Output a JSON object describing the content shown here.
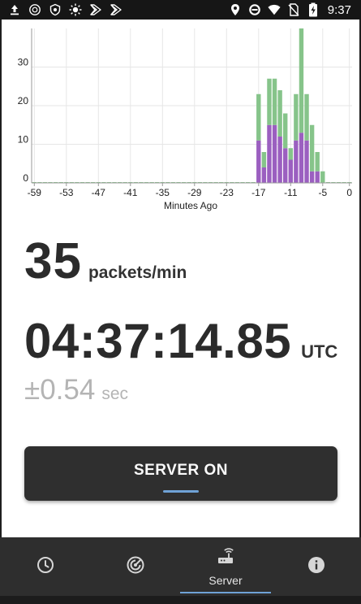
{
  "status_bar": {
    "left_icons": [
      "upload-icon",
      "app-circle-icon",
      "shield-badge-icon",
      "brightness-icon",
      "signal-flag-icon",
      "signal-flag-icon"
    ],
    "right_icons": [
      "location-icon",
      "do-not-disturb-icon",
      "wifi-icon",
      "no-sim-icon",
      "battery-charging-icon"
    ],
    "time": "9:37"
  },
  "chart_data": {
    "type": "bar",
    "stacked": true,
    "xlabel": "Minutes Ago",
    "ylabel": "",
    "xlim": [
      -59.5,
      0.5
    ],
    "ylim": [
      0,
      40
    ],
    "x_ticks": [
      -59,
      -53,
      -47,
      -41,
      -35,
      -29,
      -23,
      -17,
      -11,
      -5,
      0
    ],
    "y_ticks": [
      0,
      10,
      20,
      30
    ],
    "grid": true,
    "x": [
      -59,
      -58,
      -57,
      -56,
      -55,
      -54,
      -53,
      -52,
      -51,
      -50,
      -49,
      -48,
      -47,
      -46,
      -45,
      -44,
      -43,
      -42,
      -41,
      -40,
      -39,
      -38,
      -37,
      -36,
      -35,
      -34,
      -33,
      -32,
      -31,
      -30,
      -29,
      -28,
      -27,
      -26,
      -25,
      -24,
      -23,
      -22,
      -21,
      -20,
      -19,
      -18,
      -17,
      -16,
      -15,
      -14,
      -13,
      -12,
      -11,
      -10,
      -9,
      -8,
      -7,
      -6,
      -5,
      -4,
      -3,
      -2,
      -1,
      0
    ],
    "series": [
      {
        "color": "#9b5fc0",
        "values": [
          0,
          0,
          0,
          0,
          0,
          0,
          0,
          0,
          0,
          0,
          0,
          0,
          0,
          0,
          0,
          0,
          0,
          0,
          0,
          0,
          0,
          0,
          0,
          0,
          0,
          0,
          0,
          0,
          0,
          0,
          0,
          0,
          0,
          0,
          0,
          0,
          0,
          0,
          0,
          0,
          0,
          0,
          11,
          4,
          15,
          15,
          12,
          9,
          6,
          11,
          13,
          11,
          3,
          3,
          0,
          0,
          0,
          0,
          0,
          0
        ]
      },
      {
        "color": "#86c48a",
        "values": [
          0,
          0,
          0,
          0,
          0,
          0,
          0,
          0,
          0,
          0,
          0,
          0,
          0,
          0,
          0,
          0,
          0,
          0,
          0,
          0,
          0,
          0,
          0,
          0,
          0,
          0,
          0,
          0,
          0,
          0,
          0,
          0,
          0,
          0,
          0,
          0,
          0,
          0,
          0,
          0,
          0,
          0,
          12,
          4,
          12,
          12,
          12,
          9,
          3,
          12,
          27,
          12,
          12,
          5,
          3,
          0,
          0,
          0,
          0,
          0
        ]
      }
    ]
  },
  "packet_rate": {
    "value": "35",
    "unit": "packets/min"
  },
  "time": {
    "value": "04:37:14.85",
    "zone": "UTC"
  },
  "accuracy": {
    "value": "±0.54",
    "unit": "sec"
  },
  "server_button": {
    "label": "SERVER ON",
    "accent": "#6fa2d6"
  },
  "nav": {
    "items": [
      {
        "icon": "clock-icon",
        "label": ""
      },
      {
        "icon": "radar-icon",
        "label": ""
      },
      {
        "icon": "router-icon",
        "label": "Server"
      },
      {
        "icon": "info-icon",
        "label": ""
      }
    ],
    "selected_index": 2
  }
}
